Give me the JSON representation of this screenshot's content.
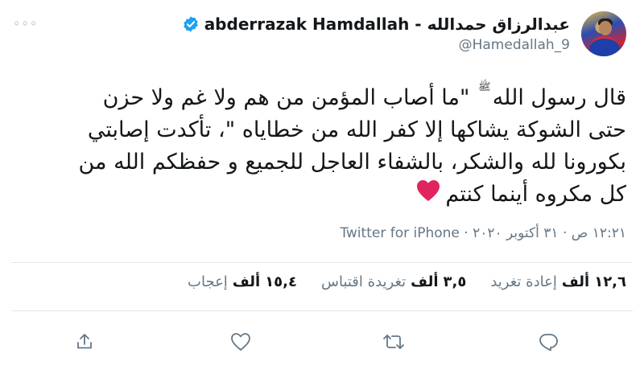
{
  "header": {
    "display_name": "abderrazak Hamdallah - عبدالرزاق حمدالله",
    "handle": "@Hamedallah_9",
    "more_label": "◦◦◦"
  },
  "tweet": {
    "lines": [
      "قال رسول الله",
      "\"ما أصاب المؤمن من هم ولا غم ولا حزن",
      "حتى الشوكة يشاكها إلا كفر الله من خطاياه \"، تأكدت إصابتي",
      "بكورونا لله والشكر، بالشفاء العاجل للجميع و حفظكم الله من",
      "كل مكروه أينما كنتم"
    ],
    "salawat": "ﷺ"
  },
  "meta": {
    "time": "١٢:٢١ ص",
    "date": "٣١ أكتوبر ٢٠٢٠",
    "separator": "·",
    "source": "Twitter for iPhone"
  },
  "stats": {
    "retweets": {
      "num": "١٢,٦",
      "unit": "ألف",
      "label": "إعادة تغريد"
    },
    "quotes": {
      "num": "٣,٥",
      "unit": "ألف",
      "label": "تغريدة اقتباس"
    },
    "likes": {
      "num": "١٥,٤",
      "unit": "ألف",
      "label": "إعجاب"
    }
  },
  "colors": {
    "text": "#14171a",
    "secondary": "#657786",
    "verified": "#1da1f2",
    "heart": "#e0245e",
    "divider": "#e1e8ed"
  },
  "icons": [
    "verified-badge-icon",
    "more-icon",
    "reply-icon",
    "retweet-icon",
    "like-icon",
    "share-icon",
    "red-heart-emoji-icon"
  ]
}
